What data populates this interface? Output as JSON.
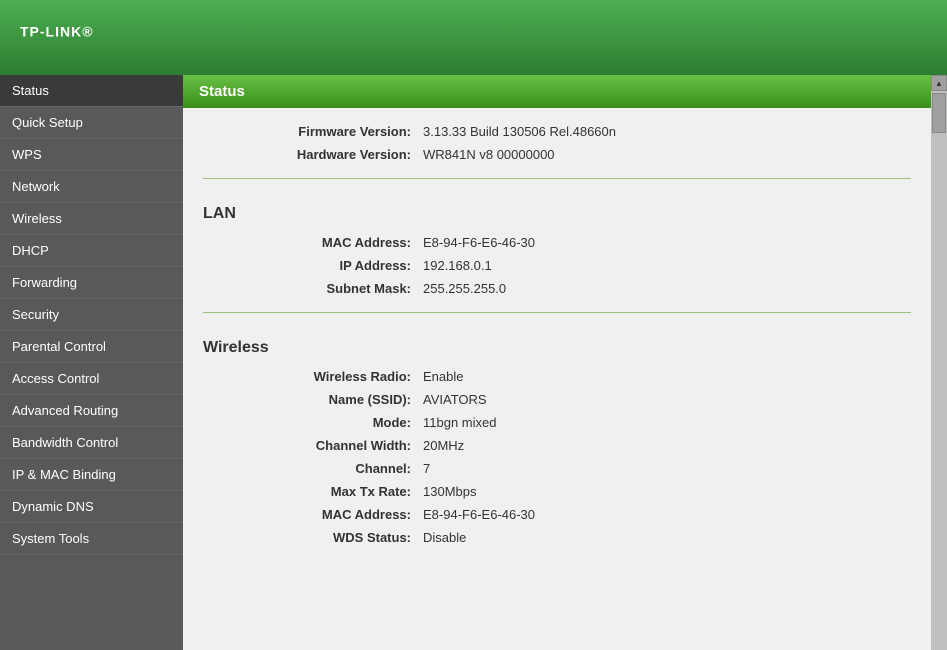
{
  "header": {
    "logo": "TP-LINK",
    "logo_tm": "®"
  },
  "sidebar": {
    "items": [
      {
        "id": "status",
        "label": "Status",
        "active": true
      },
      {
        "id": "quick-setup",
        "label": "Quick Setup"
      },
      {
        "id": "wps",
        "label": "WPS"
      },
      {
        "id": "network",
        "label": "Network"
      },
      {
        "id": "wireless",
        "label": "Wireless"
      },
      {
        "id": "dhcp",
        "label": "DHCP"
      },
      {
        "id": "forwarding",
        "label": "Forwarding"
      },
      {
        "id": "security",
        "label": "Security"
      },
      {
        "id": "parental-control",
        "label": "Parental Control"
      },
      {
        "id": "access-control",
        "label": "Access Control"
      },
      {
        "id": "advanced-routing",
        "label": "Advanced Routing"
      },
      {
        "id": "bandwidth-control",
        "label": "Bandwidth Control"
      },
      {
        "id": "ip-mac-binding",
        "label": "IP & MAC Binding"
      },
      {
        "id": "dynamic-dns",
        "label": "Dynamic DNS"
      },
      {
        "id": "system-tools",
        "label": "System Tools"
      }
    ]
  },
  "main": {
    "page_title": "Status",
    "firmware_label": "Firmware Version:",
    "firmware_value": "3.13.33 Build 130506 Rel.48660n",
    "hardware_label": "Hardware Version:",
    "hardware_value": "WR841N v8 00000000",
    "lan_title": "LAN",
    "lan_mac_label": "MAC Address:",
    "lan_mac_value": "E8-94-F6-E6-46-30",
    "lan_ip_label": "IP Address:",
    "lan_ip_value": "192.168.0.1",
    "lan_subnet_label": "Subnet Mask:",
    "lan_subnet_value": "255.255.255.0",
    "wireless_title": "Wireless",
    "wireless_radio_label": "Wireless Radio:",
    "wireless_radio_value": "Enable",
    "wireless_ssid_label": "Name (SSID):",
    "wireless_ssid_value": "AVIATORS",
    "wireless_mode_label": "Mode:",
    "wireless_mode_value": "11bgn mixed",
    "wireless_channel_width_label": "Channel Width:",
    "wireless_channel_width_value": "20MHz",
    "wireless_channel_label": "Channel:",
    "wireless_channel_value": "7",
    "wireless_max_tx_label": "Max Tx Rate:",
    "wireless_max_tx_value": "130Mbps",
    "wireless_mac_label": "MAC Address:",
    "wireless_mac_value": "E8-94-F6-E6-46-30",
    "wireless_wds_label": "WDS Status:",
    "wireless_wds_value": "Disable"
  }
}
